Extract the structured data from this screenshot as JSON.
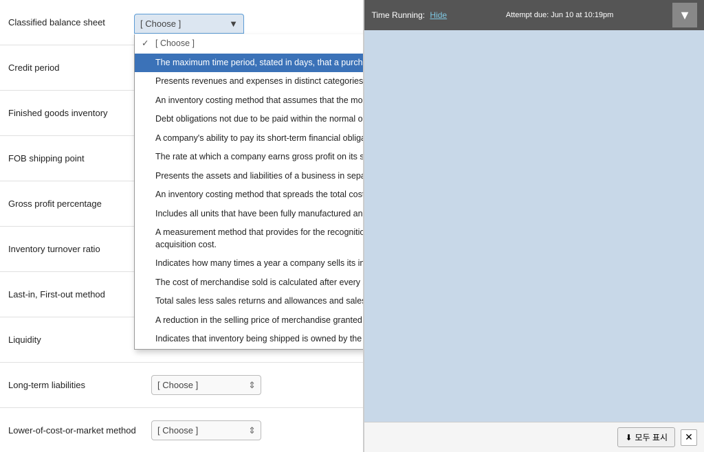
{
  "header": {
    "timer_label": "Time Running:",
    "hide_label": "Hide",
    "attempt_label": "Attempt due: Jun 10 at 10:19pm"
  },
  "terms": [
    {
      "id": "classified-balance-sheet",
      "label": "Classified balance sheet",
      "dropdown_open": true,
      "value": "[ Choose ]"
    },
    {
      "id": "credit-period",
      "label": "Credit period",
      "dropdown_open": false,
      "value": "[ Choose ]"
    },
    {
      "id": "finished-goods-inventory",
      "label": "Finished goods inventory",
      "dropdown_open": false,
      "value": "[ Choose ]"
    },
    {
      "id": "fob-shipping-point",
      "label": "FOB shipping point",
      "dropdown_open": false,
      "value": "[ Choose ]"
    },
    {
      "id": "gross-profit-percentage",
      "label": "Gross profit percentage",
      "dropdown_open": false,
      "value": "[ Choose ]"
    },
    {
      "id": "inventory-turnover-ratio",
      "label": "Inventory turnover ratio",
      "dropdown_open": false,
      "value": "[ Choose ]"
    },
    {
      "id": "last-in-first-out",
      "label": "Last-in, First-out method",
      "dropdown_open": false,
      "value": "[ Choose ]"
    },
    {
      "id": "liquidity",
      "label": "Liquidity",
      "dropdown_open": false,
      "value": "[ Choose ]"
    },
    {
      "id": "long-term-liabilities",
      "label": "Long-term liabilities",
      "dropdown_open": false,
      "value": "[ Choose ]"
    },
    {
      "id": "lower-of-cost-or-market",
      "label": "Lower-of-cost-or-market method",
      "dropdown_open": false,
      "value": "[ Choose ]"
    }
  ],
  "dropdown_options": [
    {
      "id": "choose",
      "text": "[ Choose ]",
      "checked": true,
      "highlighted": false
    },
    {
      "id": "opt1",
      "text": "The maximum time period, stated in days, that a purchaser of inventory has to pay a seller.",
      "checked": false,
      "highlighted": true
    },
    {
      "id": "opt2",
      "text": "Presents revenues and expenses in distinct categories to facilitate financial analysis.",
      "checked": false,
      "highlighted": false
    },
    {
      "id": "opt3",
      "text": "An inventory costing method that assumes that the most recent purchases are sold first.",
      "checked": false,
      "highlighted": false
    },
    {
      "id": "opt4",
      "text": "Debt obligations not due to be paid within the normal operating cycle or one year.",
      "checked": false,
      "highlighted": false
    },
    {
      "id": "opt5",
      "text": "A company's ability to pay its short-term financial obligations.",
      "checked": false,
      "highlighted": false
    },
    {
      "id": "opt6",
      "text": "The rate at which a company earns gross profit on its sales revenue.",
      "checked": false,
      "highlighted": false
    },
    {
      "id": "opt7",
      "text": "Presents the assets and liabilities of a business in separate subgroups.",
      "checked": false,
      "highlighted": false
    },
    {
      "id": "opt8",
      "text": "An inventory costing method that spreads the total cost of goods available for sale equally among all units.",
      "checked": false,
      "highlighted": false
    },
    {
      "id": "opt9",
      "text": "Includes all units that have been fully manufactured and are ready to be sold to customers.",
      "checked": false,
      "highlighted": false
    },
    {
      "id": "opt10",
      "text": "A measurement method that provides for the recognition of an inventory loss when the inventory's replacement cost declines below its acquisition cost.",
      "checked": false,
      "highlighted": false
    },
    {
      "id": "opt11",
      "text": "Indicates how many times a year a company sells its inventory.",
      "checked": false,
      "highlighted": false
    },
    {
      "id": "opt12",
      "text": "The cost of merchandise sold is calculated after every sale and the inventory balance is constantly kept up-to-date.",
      "checked": false,
      "highlighted": false
    },
    {
      "id": "opt13",
      "text": "Total sales less sales returns and allowances and sales discounts.",
      "checked": false,
      "highlighted": false
    },
    {
      "id": "opt14",
      "text": "A reduction in the selling price of merchandise granted by a seller due to dissatisfaction by the purchaser.",
      "checked": false,
      "highlighted": false
    },
    {
      "id": "opt15",
      "text": "Indicates that inventory being shipped is owned by the buyer while in transit.",
      "checked": false,
      "highlighted": false
    }
  ],
  "bottom_bar": {
    "show_all_label": "모두 표시",
    "close_label": "✕"
  }
}
